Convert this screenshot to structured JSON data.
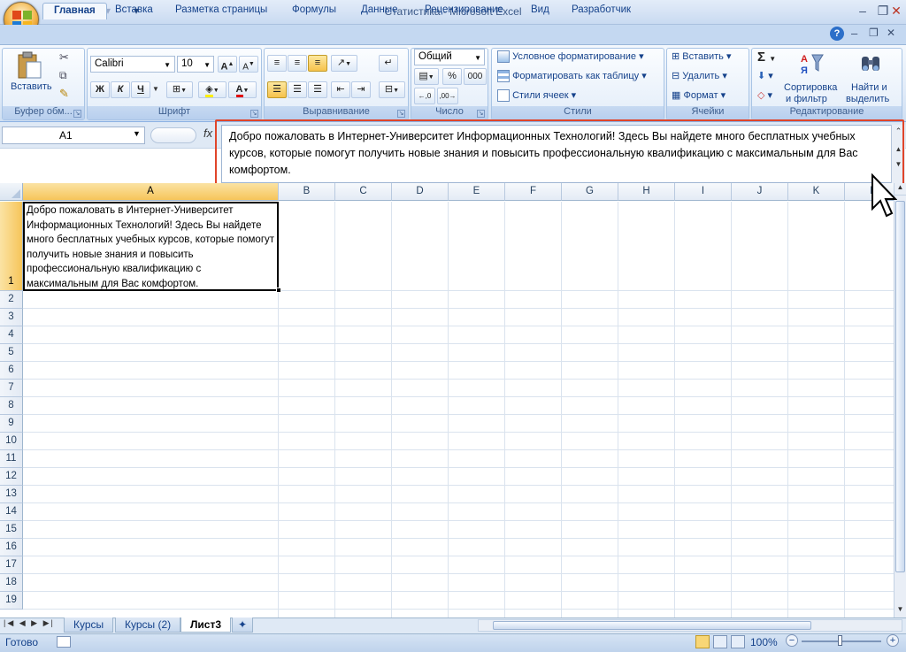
{
  "window": {
    "title": "Статистика - Microsoft Excel"
  },
  "quick_access": [
    "save-icon",
    "undo-icon",
    "redo-icon",
    "customize-icon"
  ],
  "tabs": [
    {
      "label": "Главная",
      "active": true
    },
    {
      "label": "Вставка"
    },
    {
      "label": "Разметка страницы"
    },
    {
      "label": "Формулы"
    },
    {
      "label": "Данные"
    },
    {
      "label": "Рецензирование"
    },
    {
      "label": "Вид"
    },
    {
      "label": "Разработчик"
    }
  ],
  "ribbon": {
    "clipboard": {
      "paste": "Вставить",
      "label": "Буфер обм..."
    },
    "font": {
      "name": "Calibri",
      "size": "10",
      "bold": "Ж",
      "italic": "К",
      "underline": "Ч",
      "label": "Шрифт"
    },
    "alignment": {
      "label": "Выравнивание"
    },
    "number": {
      "format": "Общий",
      "percent": "%",
      "thousands": "000",
      "label": "Число"
    },
    "styles": {
      "conditional": "Условное форматирование",
      "as_table": "Форматировать как таблицу",
      "cell_styles": "Стили ячеек",
      "label": "Стили"
    },
    "cells": {
      "insert": "Вставить",
      "delete": "Удалить",
      "format": "Формат",
      "label": "Ячейки"
    },
    "editing": {
      "sigma": "Σ",
      "sort": "Сортировка",
      "sort2": "и фильтр",
      "find": "Найти и",
      "find2": "выделить",
      "label": "Редактирование"
    }
  },
  "formula_bar": {
    "name_box": "A1",
    "fx": "fx",
    "content": "Добро пожаловать в Интернет-Университет Информационных Технологий! Здесь Вы найдете много бесплатных учебных курсов, которые помогут получить новые знания и повысить профессиональную квалификацию с максимальным для Вас комфортом."
  },
  "grid": {
    "columns": [
      "A",
      "B",
      "C",
      "D",
      "E",
      "F",
      "G",
      "H",
      "I",
      "J",
      "K",
      "L"
    ],
    "rows": [
      "1",
      "2",
      "3",
      "4",
      "5",
      "6",
      "7",
      "8",
      "9",
      "10",
      "11",
      "12",
      "13",
      "14",
      "15",
      "16",
      "17",
      "18",
      "19"
    ],
    "a1_value": "Добро пожаловать в Интернет-Университет Информационных Технологий! Здесь Вы найдете много бесплатных учебных курсов, которые помогут получить новые знания и повысить профессиональную квалификацию с максимальным для Вас комфортом."
  },
  "sheets": [
    {
      "label": "Курсы"
    },
    {
      "label": "Курсы (2)"
    },
    {
      "label": "Лист3",
      "active": true
    }
  ],
  "status": {
    "ready": "Готово",
    "zoom": "100%"
  }
}
